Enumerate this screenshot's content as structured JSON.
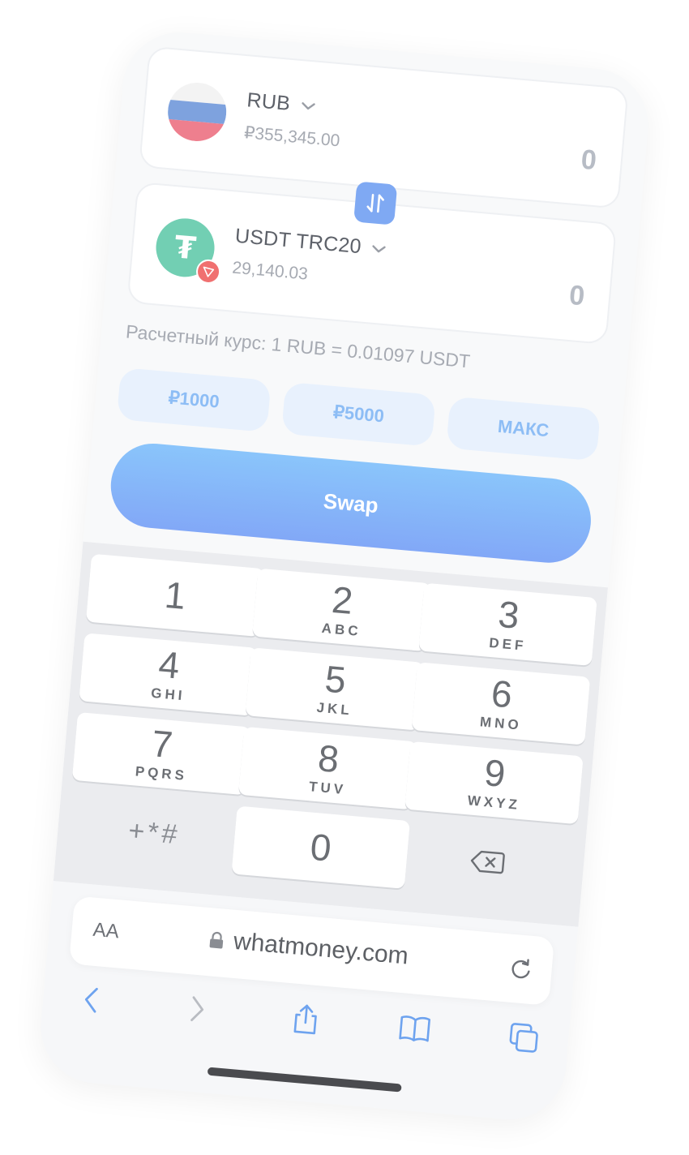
{
  "from": {
    "currency": "RUB",
    "balance": "₽355,345.00",
    "amount": "0",
    "icon": "russia-flag-icon"
  },
  "to": {
    "currency": "USDT TRC20",
    "balance": "29,140.03",
    "amount": "0",
    "icon": "tether-icon",
    "network_badge": "tron-icon"
  },
  "rate_text": "Расчетный курс: 1 RUB = 0.01097 USDT",
  "quick_amounts": [
    "₽1000",
    "₽5000",
    "МАКС"
  ],
  "swap_label": "Swap",
  "keypad": {
    "keys": [
      {
        "digit": "1",
        "letters": ""
      },
      {
        "digit": "2",
        "letters": "ABC"
      },
      {
        "digit": "3",
        "letters": "DEF"
      },
      {
        "digit": "4",
        "letters": "GHI"
      },
      {
        "digit": "5",
        "letters": "JKL"
      },
      {
        "digit": "6",
        "letters": "MNO"
      },
      {
        "digit": "7",
        "letters": "PQRS"
      },
      {
        "digit": "8",
        "letters": "TUV"
      },
      {
        "digit": "9",
        "letters": "WXYZ"
      }
    ],
    "symbols": "+*#",
    "zero": "0"
  },
  "browser": {
    "text_size_label": "AA",
    "url": "whatmoney.com"
  },
  "colors": {
    "accent": "#82a8f7",
    "quick_bg": "#e8f1fd",
    "quick_text": "#8dbdf5",
    "tether": "#72cfb3",
    "tron": "#f07070"
  }
}
